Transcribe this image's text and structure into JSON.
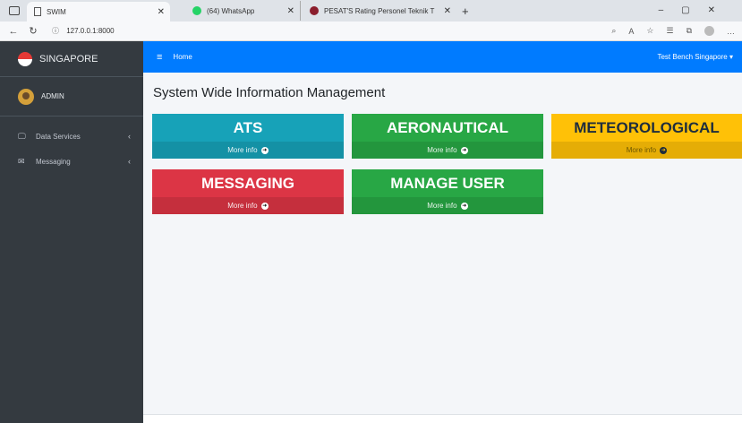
{
  "browser": {
    "tabs": [
      {
        "label": "SWIM"
      },
      {
        "label": "(64) WhatsApp"
      },
      {
        "label": "PESAT'S Rating Personel Teknik T"
      }
    ],
    "url": "127.0.0.1:8000"
  },
  "sidebar": {
    "brand": "SINGAPORE",
    "user": "ADMIN",
    "items": [
      {
        "label": "Data Services"
      },
      {
        "label": "Messaging"
      }
    ]
  },
  "navbar": {
    "home": "Home",
    "account": "Test Bench Singapore"
  },
  "main": {
    "title": "System Wide Information Management",
    "boxes": [
      {
        "title": "ATS",
        "footer": "More info"
      },
      {
        "title": "AERONAUTICAL",
        "footer": "More info"
      },
      {
        "title": "METEOROLOGICAL",
        "footer": "More info"
      },
      {
        "title": "MESSAGING",
        "footer": "More info"
      },
      {
        "title": "MANAGE USER",
        "footer": "More info"
      }
    ]
  },
  "colors": {
    "sidebar": "#343a40",
    "navbar": "#007bff",
    "ats": "#17a2b8",
    "aeronautical": "#28a745",
    "meteorological": "#ffc107",
    "messaging": "#dc3545",
    "manage_user": "#28a745"
  }
}
